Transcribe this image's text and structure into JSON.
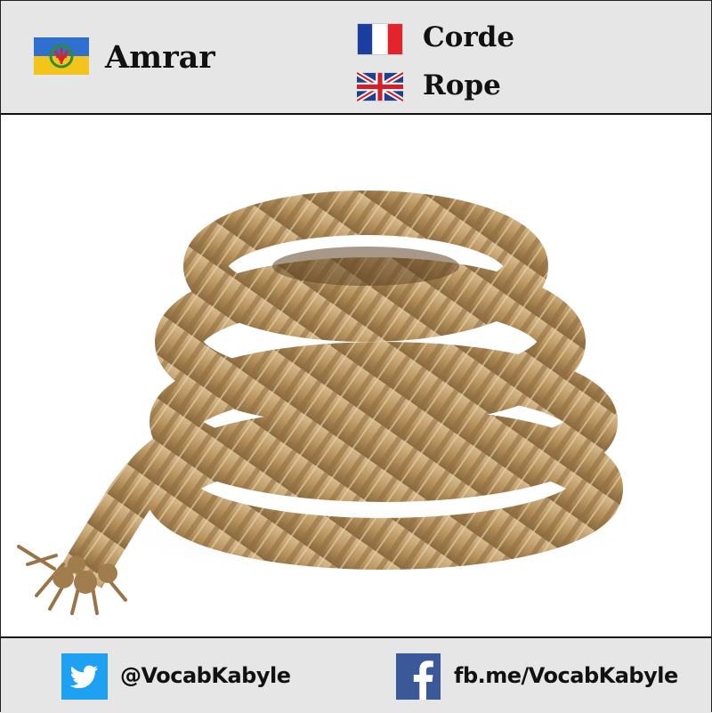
{
  "header": {
    "kabyle_word": "Amrar",
    "kabyle_flag_icon": "kabyle-flag-icon",
    "french_word": "Corde",
    "french_flag_icon": "french-flag-icon",
    "english_word": "Rope",
    "english_flag_icon": "uk-flag-icon"
  },
  "image": {
    "subject_icon": "coiled-rope-photo"
  },
  "footer": {
    "twitter_handle": "@VocabKabyle",
    "twitter_icon": "twitter-icon",
    "twitter_color": "#1da1f2",
    "facebook_link": "fb.me/VocabKabyle",
    "facebook_icon": "facebook-icon",
    "facebook_color": "#3b5998"
  },
  "colors": {
    "header_bg": "#e6e6e6",
    "footer_bg": "#e6e6e6",
    "text": "#111111"
  }
}
